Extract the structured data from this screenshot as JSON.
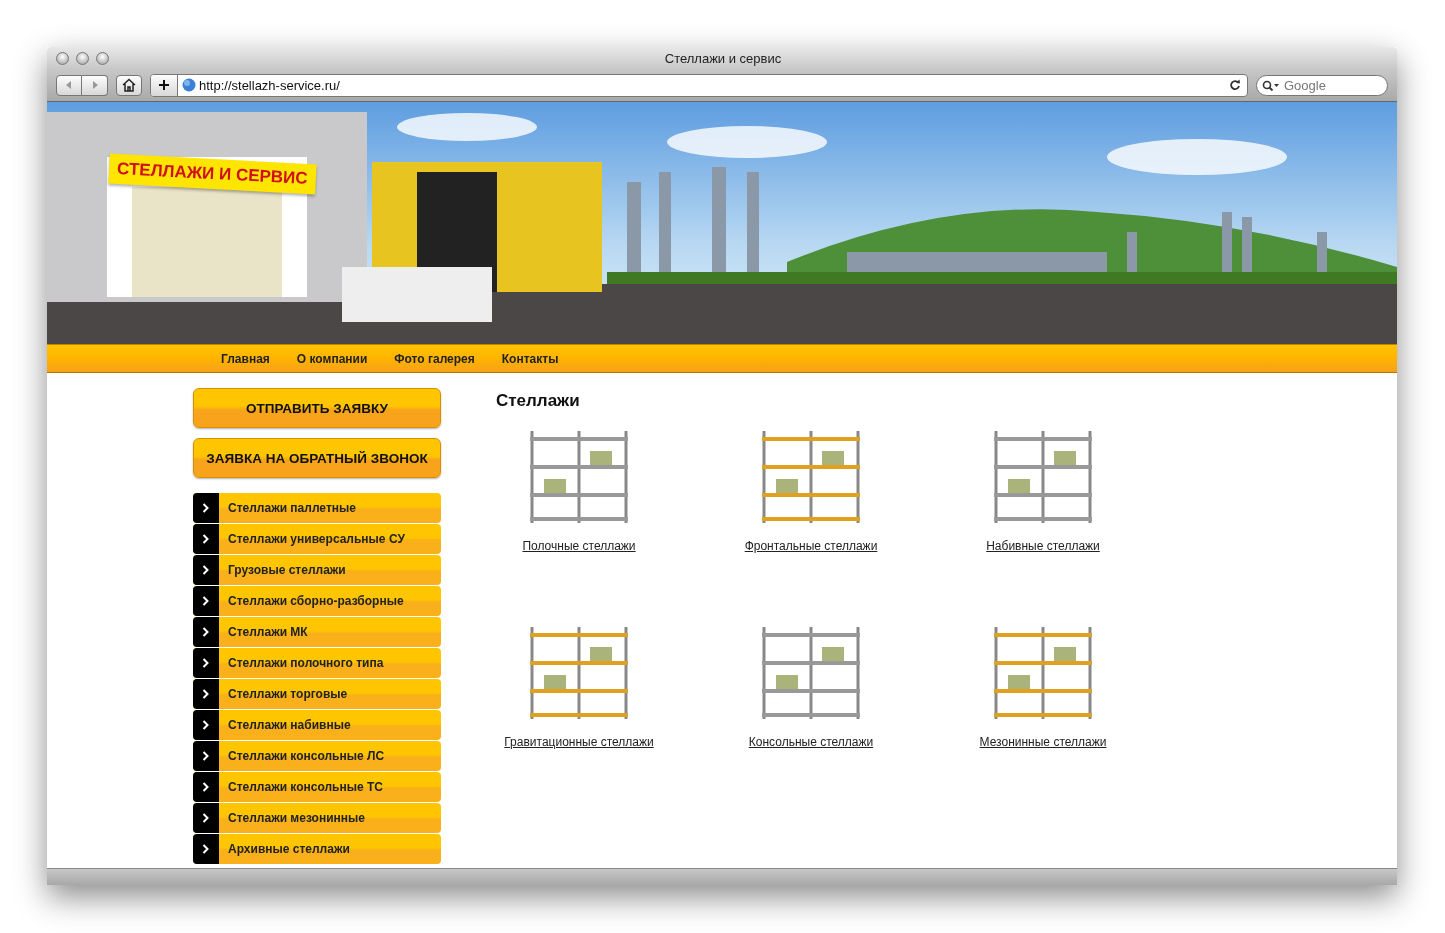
{
  "window": {
    "title": "Стеллажи и сервис"
  },
  "toolbar": {
    "url": "http://stellazh-service.ru/",
    "search": {
      "placeholder": "Google"
    }
  },
  "banner": {
    "logo": "СТЕЛЛАЖИ И СЕРВИС"
  },
  "nav": [
    "Главная",
    "О компании",
    "Фото галерея",
    "Контакты"
  ],
  "sidebar": {
    "buttons": [
      "ОТПРАВИТЬ ЗАЯВКУ",
      "ЗАЯВКА НА ОБРАТНЫЙ ЗВОНОК"
    ],
    "items": [
      "Стеллажи паллетные",
      "Стеллажи универсальные СУ",
      "Грузовые стеллажи",
      "Стеллажи сборно-разборные",
      "Стеллажи МК",
      "Стеллажи полочного типа",
      "Стеллажи торговые",
      "Стеллажи набивные",
      "Стеллажи консольные ЛС",
      "Стеллажи консольные ТС",
      "Стеллажи мезонинные",
      "Архивные стеллажи"
    ]
  },
  "main": {
    "heading": "Стеллажи",
    "products": [
      {
        "label": "Полочные стеллажи"
      },
      {
        "label": "Фронтальные стеллажи"
      },
      {
        "label": "Набивные стеллажи"
      },
      {
        "label": "Гравитационные стеллажи"
      },
      {
        "label": "Консольные стеллажи"
      },
      {
        "label": "Мезонинные стеллажи"
      }
    ]
  }
}
